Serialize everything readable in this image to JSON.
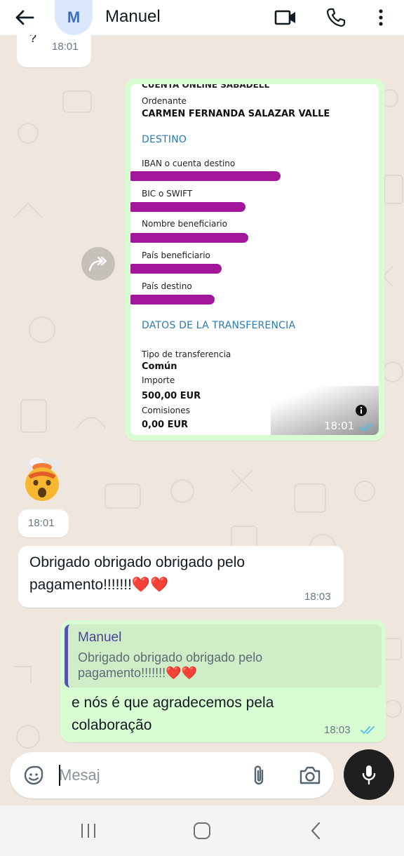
{
  "header": {
    "avatar_letter": "M",
    "contact_name": "Manuel"
  },
  "messages": {
    "first_partial": {
      "text": "?",
      "time": "18:01"
    },
    "receipt": {
      "bank_header": "CUENTA ONLINE SABADELL",
      "ordenante_label": "Ordenante",
      "ordenante_value": "CARMEN FERNANDA SALAZAR VALLE",
      "destino_section": "DESTINO",
      "iban_label": "IBAN o cuenta destino",
      "bic_label": "BIC o SWIFT",
      "beneficiario_label": "Nombre beneficiario",
      "pais_beneficiario_label": "País beneficiario",
      "pais_destino_label": "País destino",
      "datos_section": "DATOS DE LA TRANSFERENCIA",
      "tipo_label": "Tipo de transferencia",
      "tipo_value": "Común",
      "importe_label": "Importe",
      "importe_value": "500,00 EUR",
      "comisiones_label": "Comisiones",
      "comisiones_value": "0,00 EUR",
      "time": "18:01"
    },
    "emoji_msg": {
      "time": "18:01"
    },
    "incoming_thanks": {
      "text": "Obrigado obrigado obrigado pelo pagamento!!!!!!!❤️❤️",
      "time": "18:03"
    },
    "reply": {
      "quote_author": "Manuel",
      "quote_text": "Obrigado obrigado obrigado pelo pagamento!!!!!!!❤️❤️",
      "text": "e nós é que agradecemos pela colaboração",
      "time": "18:03"
    }
  },
  "input": {
    "placeholder": "Mesaj"
  },
  "colors": {
    "chat_bg": "#efe7de",
    "outgoing_bubble": "#d9fdd3",
    "incoming_bubble": "#ffffff",
    "read_ticks": "#53bdeb",
    "redaction": "#a3179b",
    "quote_accent": "#5a52b3"
  },
  "icons": {
    "back": "arrow-left-icon",
    "video": "video-camera-icon",
    "call": "phone-icon",
    "menu": "more-vertical-icon",
    "forward": "forward-arrow-icon",
    "info": "info-icon",
    "sticker": "sticker-icon",
    "attach": "paperclip-icon",
    "camera": "camera-icon",
    "mic": "microphone-icon"
  }
}
